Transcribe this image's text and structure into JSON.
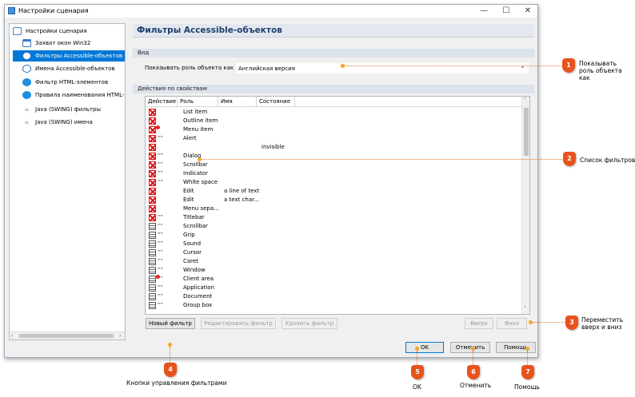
{
  "window": {
    "title": "Настройки сценария",
    "minimize_glyph": "—",
    "maximize_glyph": "☐",
    "close_glyph": "✕"
  },
  "tree": {
    "root": {
      "label": "Настройки сценария",
      "icon": "settings-icon"
    },
    "items": [
      {
        "label": "Захват окон Win32",
        "icon": "window-icon"
      },
      {
        "label": "Фильтры Accessible-объектов",
        "icon": "accessibility-icon",
        "selected": true
      },
      {
        "label": "Имена Accessible-объектов",
        "icon": "accessibility-icon"
      },
      {
        "label": "Фильтр HTML-элементов",
        "icon": "ie-icon"
      },
      {
        "label": "Правила наименования HTML-эл",
        "icon": "ie-icon"
      },
      {
        "label": "Java (SWING) фильтры",
        "icon": "java-icon"
      },
      {
        "label": "Java (SWING) имена",
        "icon": "java-icon"
      }
    ]
  },
  "panel": {
    "title": "Фильтры Accessible-объектов",
    "view_section": "Вид",
    "show_role_label": "Показывать роль объекта как",
    "show_role_value": "Английская версия",
    "actions_section": "Действия по свойствам",
    "columns": [
      "Действие",
      "Роль",
      "Имя",
      "Состояние"
    ],
    "rows": [
      {
        "action": "red",
        "opt": false,
        "role": "List item",
        "name": "",
        "state": ""
      },
      {
        "action": "red",
        "opt": false,
        "role": "Outline item",
        "name": "",
        "state": ""
      },
      {
        "action": "red",
        "opt": false,
        "role": "Menu item",
        "name": "",
        "state": "",
        "dot": true
      },
      {
        "action": "red",
        "opt": true,
        "role": "Alert",
        "name": "",
        "state": ""
      },
      {
        "action": "red",
        "opt": false,
        "role": "",
        "name": "",
        "state": "invisible"
      },
      {
        "action": "red",
        "opt": true,
        "role": "Dialog",
        "name": "",
        "state": ""
      },
      {
        "action": "red",
        "opt": true,
        "role": "Scrollbar",
        "name": "",
        "state": ""
      },
      {
        "action": "red",
        "opt": true,
        "role": "Indicator",
        "name": "",
        "state": ""
      },
      {
        "action": "red",
        "opt": true,
        "role": "White space",
        "name": "",
        "state": ""
      },
      {
        "action": "red",
        "opt": false,
        "role": "Edit",
        "name": "a line of text",
        "state": ""
      },
      {
        "action": "red",
        "opt": false,
        "role": "Edit",
        "name": "a text char...",
        "state": ""
      },
      {
        "action": "red",
        "opt": false,
        "role": "Menu sepa...",
        "name": "",
        "state": ""
      },
      {
        "action": "red",
        "opt": true,
        "role": "Titlebar",
        "name": "",
        "state": ""
      },
      {
        "action": "gray",
        "opt": true,
        "role": "Scrollbar",
        "name": "",
        "state": ""
      },
      {
        "action": "gray",
        "opt": true,
        "role": "Grip",
        "name": "",
        "state": ""
      },
      {
        "action": "gray",
        "opt": true,
        "role": "Sound",
        "name": "",
        "state": ""
      },
      {
        "action": "gray",
        "opt": true,
        "role": "Cursor",
        "name": "",
        "state": ""
      },
      {
        "action": "gray",
        "opt": true,
        "role": "Caret",
        "name": "",
        "state": ""
      },
      {
        "action": "gray",
        "opt": true,
        "role": "Window",
        "name": "",
        "state": ""
      },
      {
        "action": "gray",
        "opt": true,
        "role": "Client area",
        "name": "",
        "state": "",
        "dot": true
      },
      {
        "action": "gray",
        "opt": true,
        "role": "Application",
        "name": "",
        "state": ""
      },
      {
        "action": "gray",
        "opt": true,
        "role": "Document",
        "name": "",
        "state": ""
      },
      {
        "action": "gray",
        "opt": true,
        "role": "Group box",
        "name": "",
        "state": ""
      }
    ],
    "buttons": {
      "new": "Новый фильтр",
      "edit": "Редактировать фильтр",
      "delete": "Удалить фильтр",
      "up": "Вверх",
      "down": "Вниз"
    }
  },
  "dialog_buttons": {
    "ok": "OK",
    "cancel": "Отменить",
    "help": "Помощь"
  },
  "annotations": [
    {
      "num": "1",
      "text": "Показывать роль объекта как"
    },
    {
      "num": "2",
      "text": "Список фильтров"
    },
    {
      "num": "3",
      "text": "Переместить вверх и вниз"
    },
    {
      "num": "4",
      "text": "Кнопки управления фильтрами"
    },
    {
      "num": "5",
      "text": "OK"
    },
    {
      "num": "6",
      "text": "Отменить"
    },
    {
      "num": "7",
      "text": "Помощь"
    }
  ],
  "colors": {
    "accent": "#0078d7",
    "badge": "#e8521c",
    "annotation_line": "#e8731e",
    "selection": "#0078d7"
  }
}
